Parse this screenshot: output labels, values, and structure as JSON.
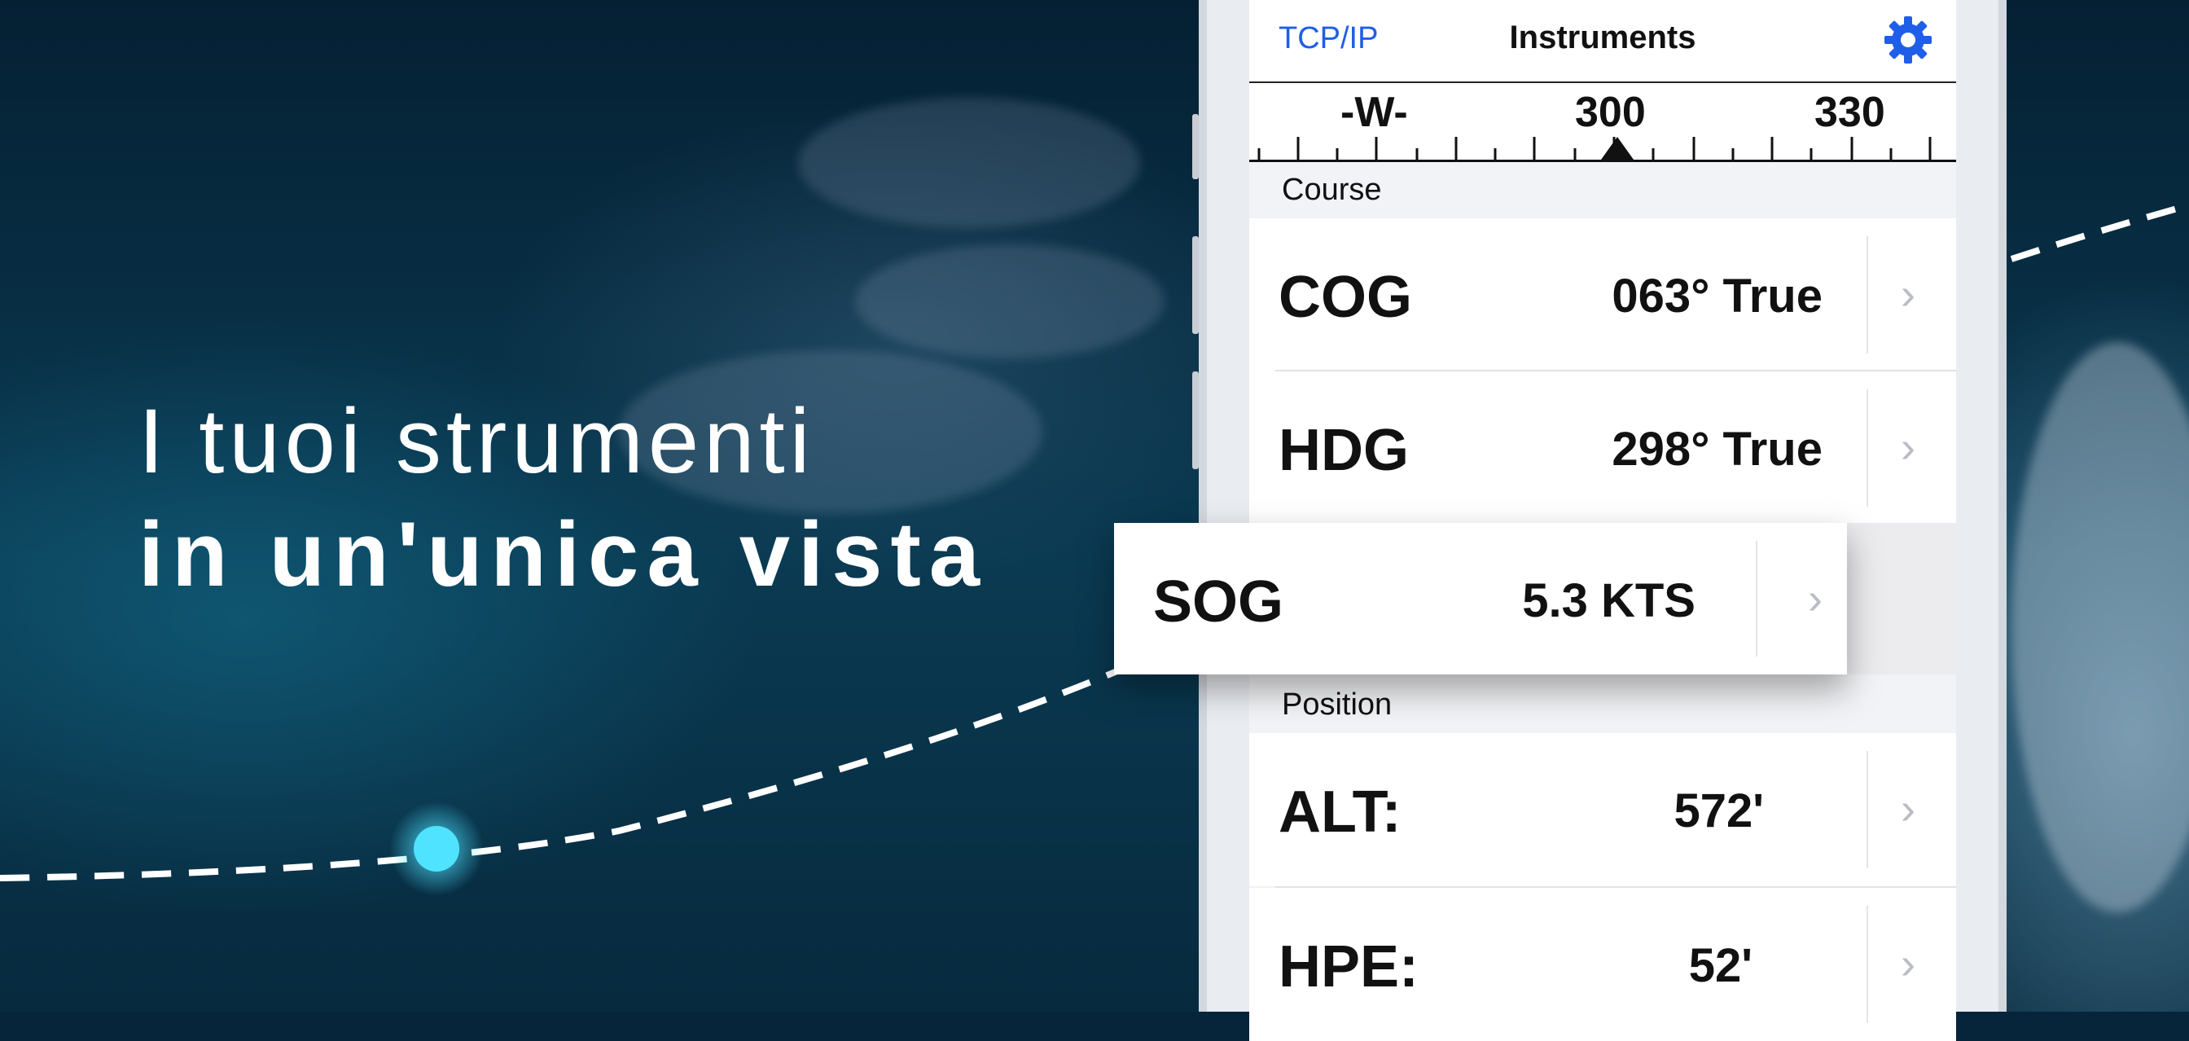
{
  "headline": {
    "line1": "I tuoi strumenti",
    "line2": "in un'unica vista"
  },
  "navbar": {
    "left_label": "TCP/IP",
    "title": "Instruments",
    "settings_icon": "gear-icon"
  },
  "compass": {
    "labels": [
      "-W-",
      "300",
      "330"
    ]
  },
  "sections": [
    {
      "header": "Course",
      "rows": [
        {
          "label": "COG",
          "value": "063° True"
        },
        {
          "label": "HDG",
          "value": "298° True"
        },
        {
          "label": "SOG",
          "value": "5.3 KTS"
        }
      ]
    },
    {
      "header": "Position",
      "rows": [
        {
          "label": "ALT:",
          "value": "572'"
        },
        {
          "label": "HPE:",
          "value": "52'"
        }
      ]
    }
  ],
  "colors": {
    "accent": "#1f5ee8",
    "ocean": "#06243a",
    "route_dot": "#4fe3ff"
  }
}
